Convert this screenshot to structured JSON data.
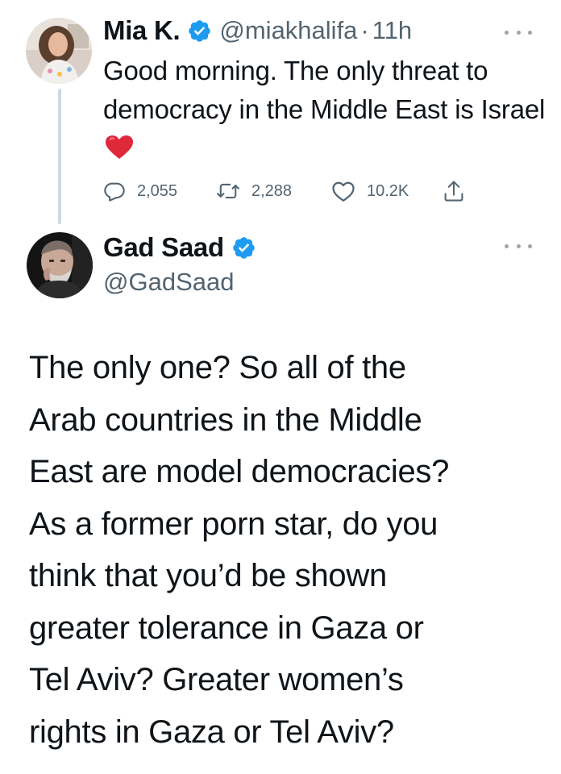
{
  "thread": {
    "tweet1": {
      "author": {
        "display_name": "Mia K.",
        "handle": "@miakhalifa",
        "separator": "·",
        "time": "11h"
      },
      "text": "Good morning. The only threat to democracy in the Middle East is Israel",
      "emoji": "heart-emoji",
      "stats": {
        "replies": "2,055",
        "retweets": "2,288",
        "likes": "10.2K"
      }
    },
    "tweet2": {
      "author": {
        "display_name": "Gad Saad",
        "handle": "@GadSaad"
      },
      "text": "The only one?  So all of the\nArab countries in the Middle\nEast are model democracies?\nAs a former porn star, do you\nthink that you’d be shown\ngreater tolerance in Gaza or\nTel Aviv? Greater women’s\nrights in Gaza or Tel Aviv?"
    }
  },
  "icons": {
    "verified": "verified-badge-icon",
    "more": "more-icon",
    "reply": "reply-icon",
    "retweet": "retweet-icon",
    "like": "like-icon",
    "share": "share-icon"
  },
  "colors": {
    "text": "#0f1419",
    "secondary": "#536471",
    "verified": "#1d9bf0",
    "emoji_heart": "#e0283b",
    "thread_line": "#cfd9de"
  }
}
